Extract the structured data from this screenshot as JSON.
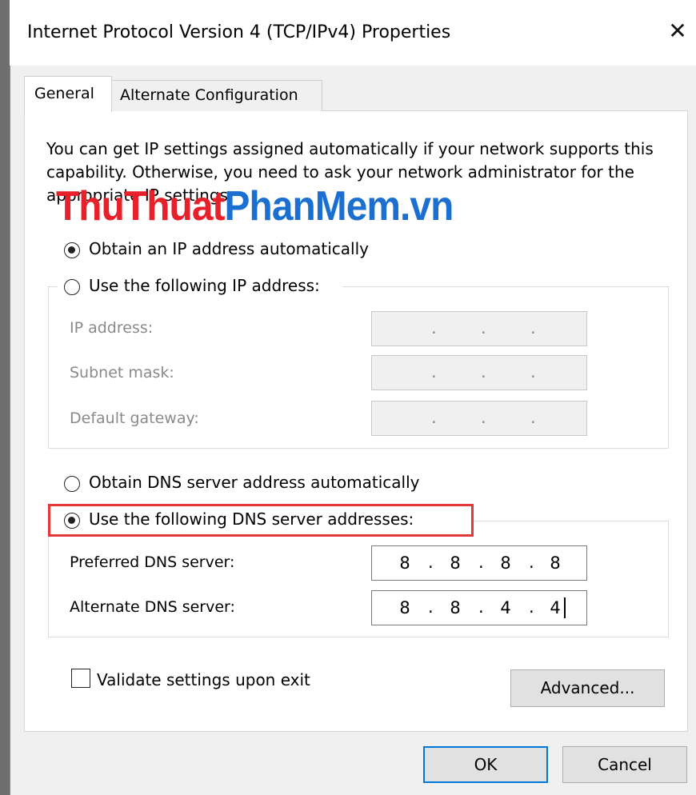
{
  "window": {
    "title": "Internet Protocol Version 4 (TCP/IPv4) Properties",
    "close_glyph": "✕"
  },
  "tabs": [
    {
      "label": "General",
      "active": true
    },
    {
      "label": "Alternate Configuration",
      "active": false
    }
  ],
  "description": "You can get IP settings assigned automatically if your network supports this capability. Otherwise, you need to ask your network administrator for the appropriate IP settings.",
  "watermark": {
    "part1": "ThuThuat",
    "part2": "PhanMem.vn",
    "color1": "#e8202a",
    "color2": "#1a6fd1"
  },
  "ip_options": {
    "auto_label": "Obtain an IP address automatically",
    "auto_selected": true,
    "manual_label": "Use the following IP address:",
    "manual_selected": false
  },
  "ip_fields": [
    {
      "label": "IP address:",
      "octets": [
        "",
        "",
        "",
        ""
      ],
      "enabled": false
    },
    {
      "label": "Subnet mask:",
      "octets": [
        "",
        "",
        "",
        ""
      ],
      "enabled": false
    },
    {
      "label": "Default gateway:",
      "octets": [
        "",
        "",
        "",
        ""
      ],
      "enabled": false
    }
  ],
  "dns_options": {
    "auto_label": "Obtain DNS server address automatically",
    "auto_selected": false,
    "manual_label": "Use the following DNS server addresses:",
    "manual_selected": true
  },
  "dns_fields": [
    {
      "label": "Preferred DNS server:",
      "octets": [
        "8",
        "8",
        "8",
        "8"
      ],
      "enabled": true
    },
    {
      "label": "Alternate DNS server:",
      "octets": [
        "8",
        "8",
        "4",
        "4"
      ],
      "enabled": true
    }
  ],
  "validate_label": "Validate settings upon exit",
  "validate_checked": false,
  "buttons": {
    "advanced": "Advanced...",
    "ok": "OK",
    "cancel": "Cancel"
  },
  "colors": {
    "highlight": "#e23a3a",
    "focus": "#0078d7"
  }
}
